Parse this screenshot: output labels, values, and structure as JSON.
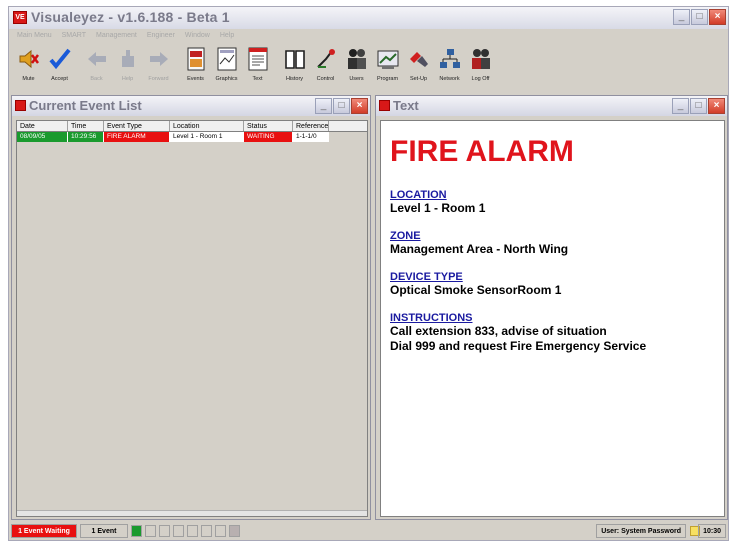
{
  "window": {
    "title": "Visualeyez - v1.6.188 - Beta 1",
    "logo_text": "VE"
  },
  "menu": [
    "Main Menu",
    "SMART",
    "Management",
    "Engineer",
    "Window",
    "Help"
  ],
  "toolbar": [
    {
      "label": "Mute",
      "icon": "speaker-mute-icon",
      "enabled": true
    },
    {
      "label": "Accept",
      "icon": "checkmark-icon",
      "enabled": true
    },
    {
      "label": "Back",
      "icon": "arrow-left-icon",
      "enabled": false
    },
    {
      "label": "Help",
      "icon": "hand-help-icon",
      "enabled": false
    },
    {
      "label": "Forward",
      "icon": "arrow-right-icon",
      "enabled": false
    },
    {
      "label": "Events",
      "icon": "events-icon",
      "enabled": true
    },
    {
      "label": "Graphics",
      "icon": "graphics-icon",
      "enabled": true
    },
    {
      "label": "Text",
      "icon": "text-icon",
      "enabled": true
    },
    {
      "label": "History",
      "icon": "book-icon",
      "enabled": true
    },
    {
      "label": "Control",
      "icon": "control-icon",
      "enabled": true
    },
    {
      "label": "Users",
      "icon": "users-icon",
      "enabled": true
    },
    {
      "label": "Program",
      "icon": "program-icon",
      "enabled": true
    },
    {
      "label": "Set-Up",
      "icon": "setup-icon",
      "enabled": true
    },
    {
      "label": "Network",
      "icon": "network-icon",
      "enabled": true
    },
    {
      "label": "Log Off",
      "icon": "logoff-icon",
      "enabled": true
    }
  ],
  "event_panel": {
    "title": "Current Event List",
    "columns": [
      "Date",
      "Time",
      "Event Type",
      "Location",
      "Status",
      "Reference"
    ],
    "rows": [
      {
        "date": "08/09/05",
        "time": "10:29:56",
        "type": "FIRE ALARM",
        "location": "Level 1 - Room 1",
        "status": "WAITING",
        "reference": "1-1-1/0"
      }
    ]
  },
  "text_panel": {
    "title": "Text",
    "alarm_title": "FIRE ALARM",
    "sections": [
      {
        "heading": "LOCATION",
        "lines": [
          "Level 1 - Room 1"
        ]
      },
      {
        "heading": "ZONE",
        "lines": [
          "Management Area - North Wing"
        ]
      },
      {
        "heading": "DEVICE TYPE",
        "lines": [
          "Optical Smoke SensorRoom 1"
        ]
      },
      {
        "heading": "INSTRUCTIONS",
        "lines": [
          "Call extension 833, advise of situation",
          "Dial 999 and request Fire Emergency Service"
        ]
      }
    ]
  },
  "statusbar": {
    "waiting": "1 Event Waiting",
    "count": "1 Event",
    "user": "User: System Password",
    "time": "10:30"
  },
  "colors": {
    "alarm_red": "#e81010",
    "ok_green": "#1a9a2e",
    "heading_blue": "#1a1aa0"
  }
}
